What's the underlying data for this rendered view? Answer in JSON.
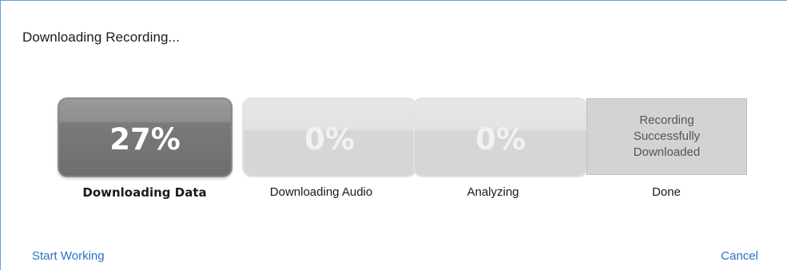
{
  "dialog": {
    "title": "Downloading Recording..."
  },
  "stages": [
    {
      "percent_label": "27%",
      "label": "Downloading Data",
      "progress": 27,
      "state": "active"
    },
    {
      "percent_label": "0%",
      "label": "Downloading Audio",
      "progress": 0,
      "state": "pending"
    },
    {
      "percent_label": "0%",
      "label": "Analyzing",
      "progress": 0,
      "state": "pending"
    },
    {
      "done_text": "Recording\nSuccessfully\nDownloaded",
      "label": "Done",
      "state": "pending"
    }
  ],
  "footer": {
    "start_working_label": "Start Working",
    "cancel_label": "Cancel"
  },
  "colors": {
    "link": "#2a6fc9",
    "active_stage": "#7a7a7a",
    "inactive_stage": "#d6d6d6",
    "border_accent": "#6e9bd6"
  }
}
